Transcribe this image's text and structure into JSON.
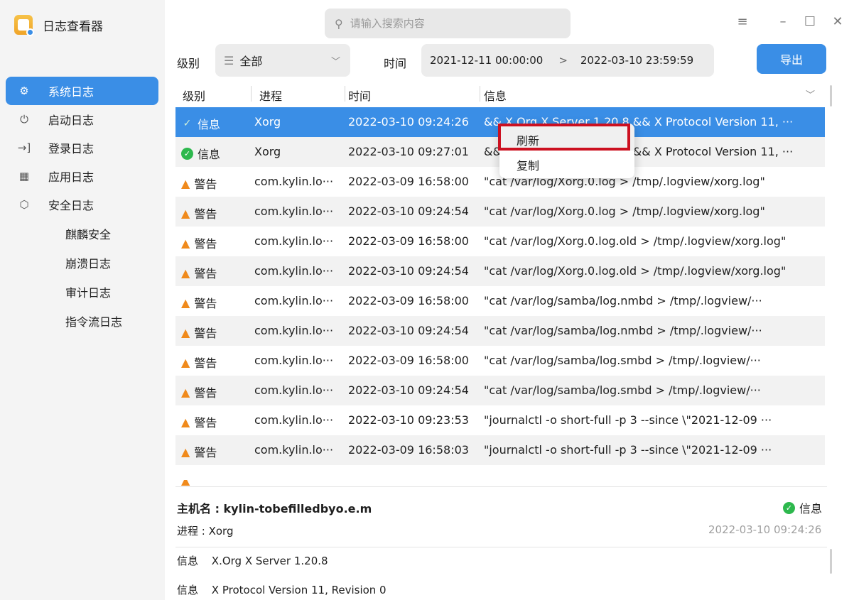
{
  "app": {
    "name": "日志查看器"
  },
  "search": {
    "placeholder": "请输入搜索内容"
  },
  "window_controls": {
    "menu": "≡",
    "minimize": "–",
    "maximize": "☐",
    "close": "✕"
  },
  "sidebar": {
    "items": [
      {
        "label": "系统日志",
        "icon": "gear-icon",
        "glyph": "⚙",
        "active": true
      },
      {
        "label": "启动日志",
        "icon": "power-icon",
        "glyph": "⏻",
        "active": false
      },
      {
        "label": "登录日志",
        "icon": "login-icon",
        "glyph": "→]",
        "active": false
      },
      {
        "label": "应用日志",
        "icon": "apps-grid-icon",
        "glyph": "▦",
        "active": false
      },
      {
        "label": "安全日志",
        "icon": "shield-icon",
        "glyph": "⬡",
        "active": false
      }
    ],
    "subitems": [
      "麒麟安全",
      "崩溃日志",
      "审计日志",
      "指令流日志"
    ]
  },
  "filters": {
    "level_label": "级别",
    "level_value": "全部",
    "time_label": "时间",
    "start": "2021-12-11 00:00:00",
    "end": "2022-03-10 23:59:59",
    "export_label": "导出"
  },
  "table": {
    "headers": {
      "level": "级别",
      "process": "进程",
      "time": "时间",
      "info": "信息"
    },
    "rows": [
      {
        "type": "ok",
        "level": "信息",
        "process": "Xorg",
        "time": "2022-03-10 09:24:26",
        "info": "&& X.Org X Server 1.20.8 && X Protocol Version 11, ···"
      },
      {
        "type": "ok",
        "level": "信息",
        "process": "Xorg",
        "time": "2022-03-10 09:27:01",
        "info": "&& X.Org X Server 1.20.8 && X Protocol Version 11, ···"
      },
      {
        "type": "warn",
        "level": "警告",
        "process": "com.kylin.lo···",
        "time": "2022-03-09 16:58:00",
        "info": "\"cat /var/log/Xorg.0.log > /tmp/.logview/xorg.log\""
      },
      {
        "type": "warn",
        "level": "警告",
        "process": "com.kylin.lo···",
        "time": "2022-03-10 09:24:54",
        "info": "\"cat /var/log/Xorg.0.log > /tmp/.logview/xorg.log\""
      },
      {
        "type": "warn",
        "level": "警告",
        "process": "com.kylin.lo···",
        "time": "2022-03-09 16:58:00",
        "info": "\"cat /var/log/Xorg.0.log.old > /tmp/.logview/xorg.log\""
      },
      {
        "type": "warn",
        "level": "警告",
        "process": "com.kylin.lo···",
        "time": "2022-03-10 09:24:54",
        "info": "\"cat /var/log/Xorg.0.log.old > /tmp/.logview/xorg.log\""
      },
      {
        "type": "warn",
        "level": "警告",
        "process": "com.kylin.lo···",
        "time": "2022-03-09 16:58:00",
        "info": "\"cat /var/log/samba/log.nmbd > /tmp/.logview/···"
      },
      {
        "type": "warn",
        "level": "警告",
        "process": "com.kylin.lo···",
        "time": "2022-03-10 09:24:54",
        "info": "\"cat /var/log/samba/log.nmbd > /tmp/.logview/···"
      },
      {
        "type": "warn",
        "level": "警告",
        "process": "com.kylin.lo···",
        "time": "2022-03-09 16:58:00",
        "info": "\"cat /var/log/samba/log.smbd > /tmp/.logview/···"
      },
      {
        "type": "warn",
        "level": "警告",
        "process": "com.kylin.lo···",
        "time": "2022-03-10 09:24:54",
        "info": "\"cat /var/log/samba/log.smbd > /tmp/.logview/···"
      },
      {
        "type": "warn",
        "level": "警告",
        "process": "com.kylin.lo···",
        "time": "2022-03-10 09:23:53",
        "info": "\"journalctl -o short-full -p 3 --since \\\"2021-12-09 ···"
      },
      {
        "type": "warn",
        "level": "警告",
        "process": "com.kylin.lo···",
        "time": "2022-03-09 16:58:03",
        "info": "\"journalctl -o short-full -p 3 --since \\\"2021-12-09 ···"
      }
    ]
  },
  "context_menu": {
    "items": [
      "刷新",
      "复制"
    ]
  },
  "detail": {
    "host": "主机名 : kylin-tobefilledbyo.e.m",
    "level": "信息",
    "process": "进程 : Xorg",
    "time": "2022-03-10 09:24:26",
    "lines": [
      {
        "key": "信息",
        "value": "X.Org X Server 1.20.8"
      },
      {
        "key": "信息",
        "value": "X Protocol Version 11, Revision 0"
      }
    ]
  }
}
